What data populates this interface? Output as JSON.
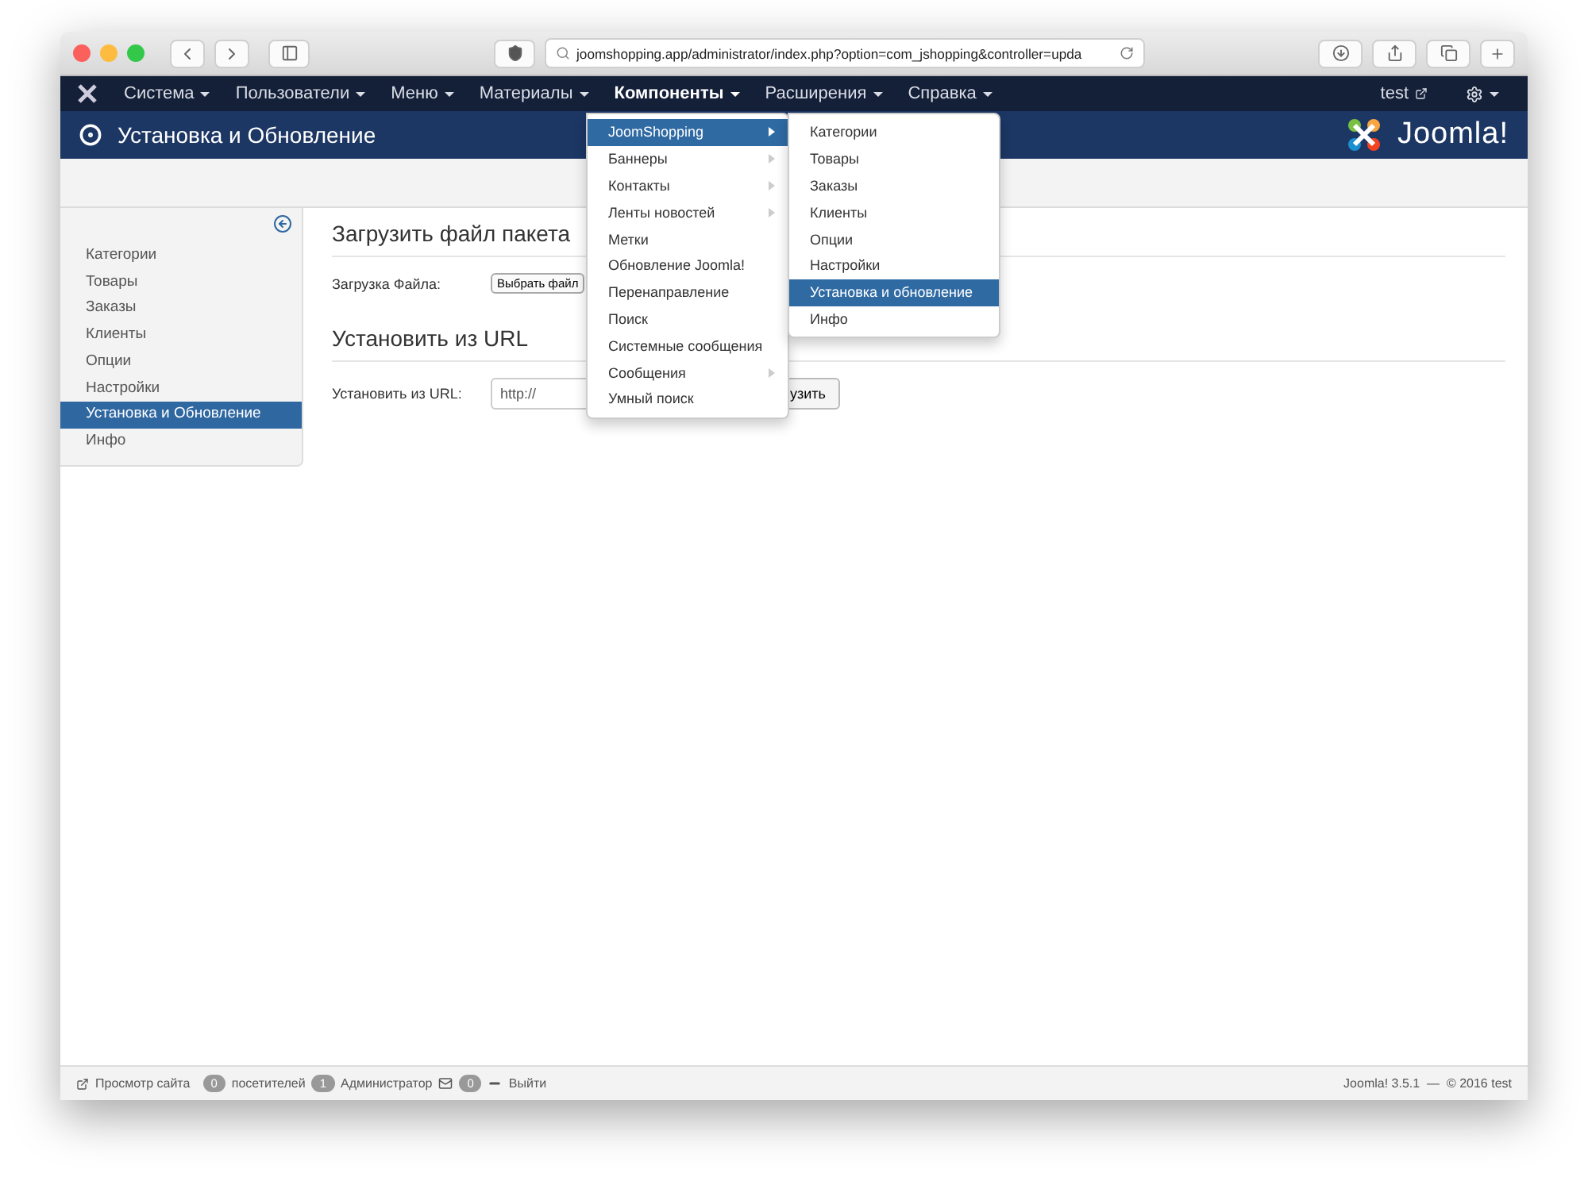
{
  "browser": {
    "url": "joomshopping.app/administrator/index.php?option=com_jshopping&controller=upda"
  },
  "nav": {
    "items": [
      {
        "label": "Система",
        "selected": false
      },
      {
        "label": "Пользователи",
        "selected": false
      },
      {
        "label": "Меню",
        "selected": false
      },
      {
        "label": "Материалы",
        "selected": false
      },
      {
        "label": "Компоненты",
        "selected": true
      },
      {
        "label": "Расширения",
        "selected": false
      },
      {
        "label": "Справка",
        "selected": false
      }
    ],
    "user": "test"
  },
  "header": {
    "title": "Установка и Обновление",
    "logo": "Joomla!"
  },
  "sidebar": {
    "items": [
      {
        "label": "Категории",
        "selected": false
      },
      {
        "label": "Товары",
        "selected": false
      },
      {
        "label": "Заказы",
        "selected": false
      },
      {
        "label": "Клиенты",
        "selected": false
      },
      {
        "label": "Опции",
        "selected": false
      },
      {
        "label": "Настройки",
        "selected": false
      },
      {
        "label": "Установка и Обновление",
        "selected": true
      },
      {
        "label": "Инфо",
        "selected": false
      }
    ]
  },
  "sections": [
    {
      "heading": "Загрузить файл пакета",
      "label": "Загрузка Файла:",
      "kind": "file",
      "control": "Выбрать файл"
    },
    {
      "heading": "Установить из URL",
      "label": "Установить из URL:",
      "kind": "url",
      "value": "http://",
      "button": "узить"
    }
  ],
  "menu": {
    "items": [
      {
        "label": "JoomShopping",
        "submenu": true,
        "selected": true
      },
      {
        "label": "Баннеры",
        "submenu": true,
        "selected": false
      },
      {
        "label": "Контакты",
        "submenu": true,
        "selected": false
      },
      {
        "label": "Ленты новостей",
        "submenu": true,
        "selected": false
      },
      {
        "label": "Метки",
        "submenu": false,
        "selected": false
      },
      {
        "label": "Обновление Joomla!",
        "submenu": false,
        "selected": false
      },
      {
        "label": "Перенаправление",
        "submenu": false,
        "selected": false
      },
      {
        "label": "Поиск",
        "submenu": false,
        "selected": false
      },
      {
        "label": "Системные сообщения",
        "submenu": false,
        "selected": false
      },
      {
        "label": "Сообщения",
        "submenu": true,
        "selected": false
      },
      {
        "label": "Умный поиск",
        "submenu": false,
        "selected": false
      }
    ]
  },
  "submenu": {
    "items": [
      {
        "label": "Категории",
        "selected": false
      },
      {
        "label": "Товары",
        "selected": false
      },
      {
        "label": "Заказы",
        "selected": false
      },
      {
        "label": "Клиенты",
        "selected": false
      },
      {
        "label": "Опции",
        "selected": false
      },
      {
        "label": "Настройки",
        "selected": false
      },
      {
        "label": "Установка и обновление",
        "selected": true
      },
      {
        "label": "Инфо",
        "selected": false
      }
    ]
  },
  "status_bar": {
    "view_site": "Просмотр сайта",
    "visitors_count": "0",
    "visitors": "посетителей",
    "admins_count": "1",
    "admins": "Администратор",
    "messages_count": "0",
    "logout": "Выйти",
    "version": "Joomla! 3.5.1  —  © 2016 test"
  }
}
